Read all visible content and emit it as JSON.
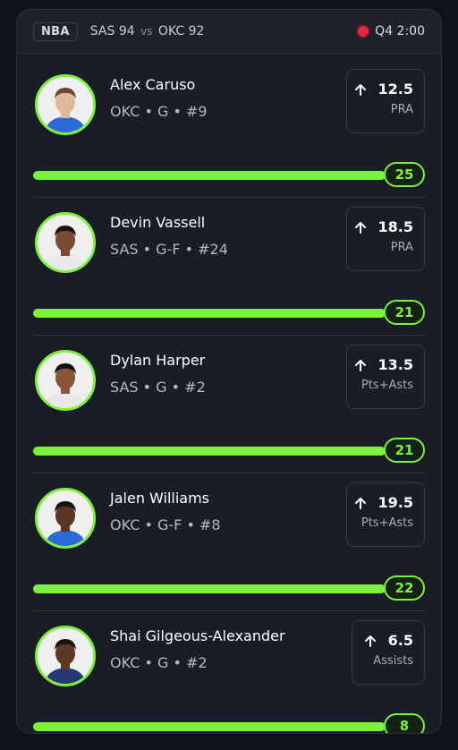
{
  "header": {
    "league": "NBA",
    "home_team": "SAS",
    "home_score": "94",
    "vs": "vs",
    "away_team": "OKC",
    "away_score": "92",
    "game_clock": "Q4 2:00",
    "live_color": "#e3283b"
  },
  "accent_color": "#7cf23a",
  "players": [
    {
      "name": "Alex Caruso",
      "meta": "OKC • G • #9",
      "direction_icon": "arrow-up-icon",
      "line": "12.5",
      "stat": "PRA",
      "current": "25",
      "progress": 1.0,
      "skin": "#e2b89c",
      "hair": "#6b4a2f",
      "jersey": "#2b6bd6"
    },
    {
      "name": "Devin Vassell",
      "meta": "SAS • G-F • #24",
      "direction_icon": "arrow-up-icon",
      "line": "18.5",
      "stat": "PRA",
      "current": "21",
      "progress": 1.0,
      "skin": "#7b4a33",
      "hair": "#1a1210",
      "jersey": "#e8e8e8"
    },
    {
      "name": "Dylan Harper",
      "meta": "SAS • G • #2",
      "direction_icon": "arrow-up-icon",
      "line": "13.5",
      "stat": "Pts+Asts",
      "current": "21",
      "progress": 1.0,
      "skin": "#8a5638",
      "hair": "#15100d",
      "jersey": "#e8e8e8"
    },
    {
      "name": "Jalen Williams",
      "meta": "OKC • G-F • #8",
      "direction_icon": "arrow-up-icon",
      "line": "19.5",
      "stat": "Pts+Asts",
      "current": "22",
      "progress": 1.0,
      "skin": "#5b3422",
      "hair": "#1b120e",
      "jersey": "#2b6bd6"
    },
    {
      "name": "Shai Gilgeous-Alexander",
      "meta": "OKC • G • #2",
      "direction_icon": "arrow-up-icon",
      "line": "6.5",
      "stat": "Assists",
      "current": "8",
      "progress": 1.0,
      "skin": "#5e3725",
      "hair": "#1b120e",
      "jersey": "#233a74"
    }
  ]
}
